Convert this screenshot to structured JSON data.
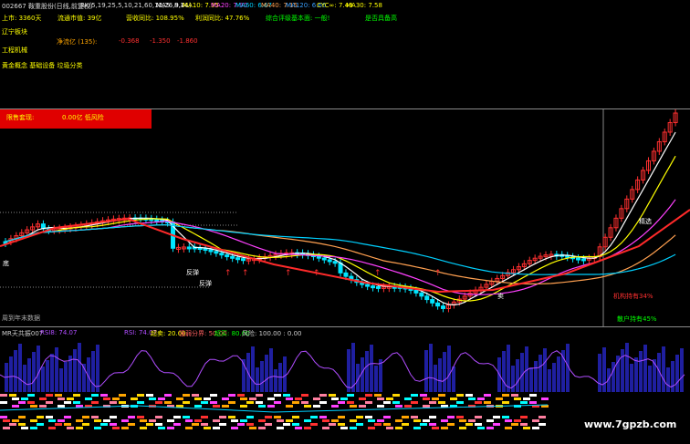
{
  "colors": {
    "up": "#ff3030",
    "down": "#00e5ff",
    "ma5": "#ffffff",
    "ma10": "#ffff00",
    "ma20": "#ff40ff",
    "ma60": "#00d0ff",
    "ma40": "#ffa050",
    "bar": "#1f1fa0",
    "rsi": "#b04dff",
    "green": "#00ff00"
  },
  "header": {
    "code": "002667 鞍重股份(日线,前复权)",
    "bk": "BK(5,19,25,5,10,21,60,12,26,9,41)",
    "ma5": "MA5: 8.14",
    "ma10": "MA10: 7.95",
    "ma20": "MA20: 7.90",
    "ma60": "MA60: 6.67",
    "ma40": "MA40: 7.15",
    "ma120": "MA120: 6.66",
    "cyc": "CYC∞: 7.49",
    "ma30": "MA30: 7.58"
  },
  "info": {
    "listed": "上市: 3360天",
    "float": "流通市值: 39亿",
    "growth": "营收同比: 108.95%",
    "profit": "利润同比: 47.76%",
    "rating": "综合评级基本面: 一般!",
    "concept": "是否具备高",
    "region": "辽宁板块",
    "industry": "工程机械",
    "netflow": "净流亿 (135):",
    "nv1": "-0.368",
    "nv2": "-1.350",
    "nv3": "-1.860",
    "tags": "黄金概念 基础设备 垃圾分类",
    "lock_label": "限售套现:",
    "lock_value": "0.00亿 低风险"
  },
  "chart_labels": {
    "jigou": "机构持有34%",
    "sanhu": "散户持有45%",
    "footer_left": "周到年末数据",
    "label_d1": "底",
    "label_fan1": "反弹",
    "label_fan2": "反弹",
    "label_mai": "卖",
    "label_chuan": "精选"
  },
  "indicator": {
    "name": "MR天共振007",
    "rsi1": "RSI8: 74.07",
    "rsi2": "RSI: 74.07",
    "over": "超卖: 20.00",
    "mid": "强弱分界: 50.00",
    "buy": "超买: 80.00",
    "top": "风险: 100.00 : 0.00"
  },
  "watermark": "www.7gpzb.com"
}
